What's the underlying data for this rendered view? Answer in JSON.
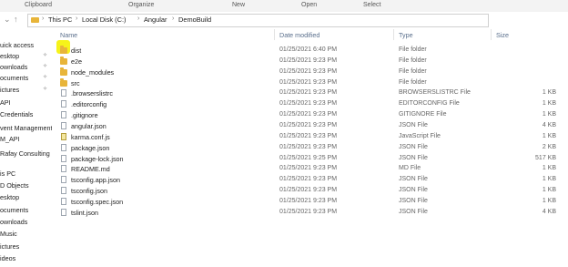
{
  "ribbon": {
    "labels": [
      "Clipboard",
      "Organize",
      "New",
      "Open",
      "Select"
    ]
  },
  "address_bar": {
    "crumbs": [
      "This PC",
      "Local Disk (C:)",
      "Angular",
      "DemoBuild"
    ]
  },
  "nav_pane": {
    "items": [
      {
        "label": "uick access",
        "pinned": false
      },
      {
        "label": "esktop",
        "pinned": true
      },
      {
        "label": "ownloads",
        "pinned": true
      },
      {
        "label": "ocuments",
        "pinned": true
      },
      {
        "label": "ictures",
        "pinned": true
      },
      {
        "label": "API",
        "pinned": false
      },
      {
        "label": "Credentials",
        "pinned": false
      },
      {
        "label": "vent Management",
        "pinned": false
      },
      {
        "label": "M_API",
        "pinned": false
      },
      {
        "label": "Rafay Consulting",
        "pinned": false
      },
      {
        "label": "is PC",
        "pinned": false
      },
      {
        "label": "D Objects",
        "pinned": false
      },
      {
        "label": "esktop",
        "pinned": false
      },
      {
        "label": "ocuments",
        "pinned": false
      },
      {
        "label": "ownloads",
        "pinned": false
      },
      {
        "label": "Music",
        "pinned": false
      },
      {
        "label": "ictures",
        "pinned": false
      },
      {
        "label": "ideos",
        "pinned": false
      }
    ]
  },
  "columns": {
    "name": "Name",
    "date": "Date modified",
    "type": "Type",
    "size": "Size"
  },
  "files": [
    {
      "name": "dist",
      "date": "01/25/2021 6:40 PM",
      "type": "File folder",
      "size": "",
      "icon": "folder-icon",
      "highlighted": true
    },
    {
      "name": "e2e",
      "date": "01/25/2021 9:23 PM",
      "type": "File folder",
      "size": "",
      "icon": "folder-icon"
    },
    {
      "name": "node_modules",
      "date": "01/25/2021 9:23 PM",
      "type": "File folder",
      "size": "",
      "icon": "folder-icon"
    },
    {
      "name": "src",
      "date": "01/25/2021 9:23 PM",
      "type": "File folder",
      "size": "",
      "icon": "folder-icon"
    },
    {
      "name": ".browserslistrc",
      "date": "01/25/2021 9:23 PM",
      "type": "BROWSERSLISTRC File",
      "size": "1 KB",
      "icon": "file-icon"
    },
    {
      "name": ".editorconfig",
      "date": "01/25/2021 9:23 PM",
      "type": "EDITORCONFIG File",
      "size": "1 KB",
      "icon": "file-icon"
    },
    {
      "name": ".gitignore",
      "date": "01/25/2021 9:23 PM",
      "type": "GITIGNORE File",
      "size": "1 KB",
      "icon": "file-icon"
    },
    {
      "name": "angular.json",
      "date": "01/25/2021 9:23 PM",
      "type": "JSON File",
      "size": "4 KB",
      "icon": "file-icon"
    },
    {
      "name": "karma.conf.js",
      "date": "01/25/2021 9:23 PM",
      "type": "JavaScript File",
      "size": "1 KB",
      "icon": "js-file-icon"
    },
    {
      "name": "package.json",
      "date": "01/25/2021 9:23 PM",
      "type": "JSON File",
      "size": "2 KB",
      "icon": "file-icon"
    },
    {
      "name": "package-lock.json",
      "date": "01/25/2021 9:25 PM",
      "type": "JSON File",
      "size": "517 KB",
      "icon": "file-icon"
    },
    {
      "name": "README.md",
      "date": "01/25/2021 9:23 PM",
      "type": "MD File",
      "size": "1 KB",
      "icon": "file-icon"
    },
    {
      "name": "tsconfig.app.json",
      "date": "01/25/2021 9:23 PM",
      "type": "JSON File",
      "size": "1 KB",
      "icon": "file-icon"
    },
    {
      "name": "tsconfig.json",
      "date": "01/25/2021 9:23 PM",
      "type": "JSON File",
      "size": "1 KB",
      "icon": "file-icon"
    },
    {
      "name": "tsconfig.spec.json",
      "date": "01/25/2021 9:23 PM",
      "type": "JSON File",
      "size": "1 KB",
      "icon": "file-icon"
    },
    {
      "name": "tslint.json",
      "date": "01/25/2021 9:23 PM",
      "type": "JSON File",
      "size": "4 KB",
      "icon": "file-icon"
    }
  ],
  "colors": {
    "highlight": "#f6f31a",
    "folder": "#e8b53a",
    "header_text": "#5a6f8c"
  }
}
